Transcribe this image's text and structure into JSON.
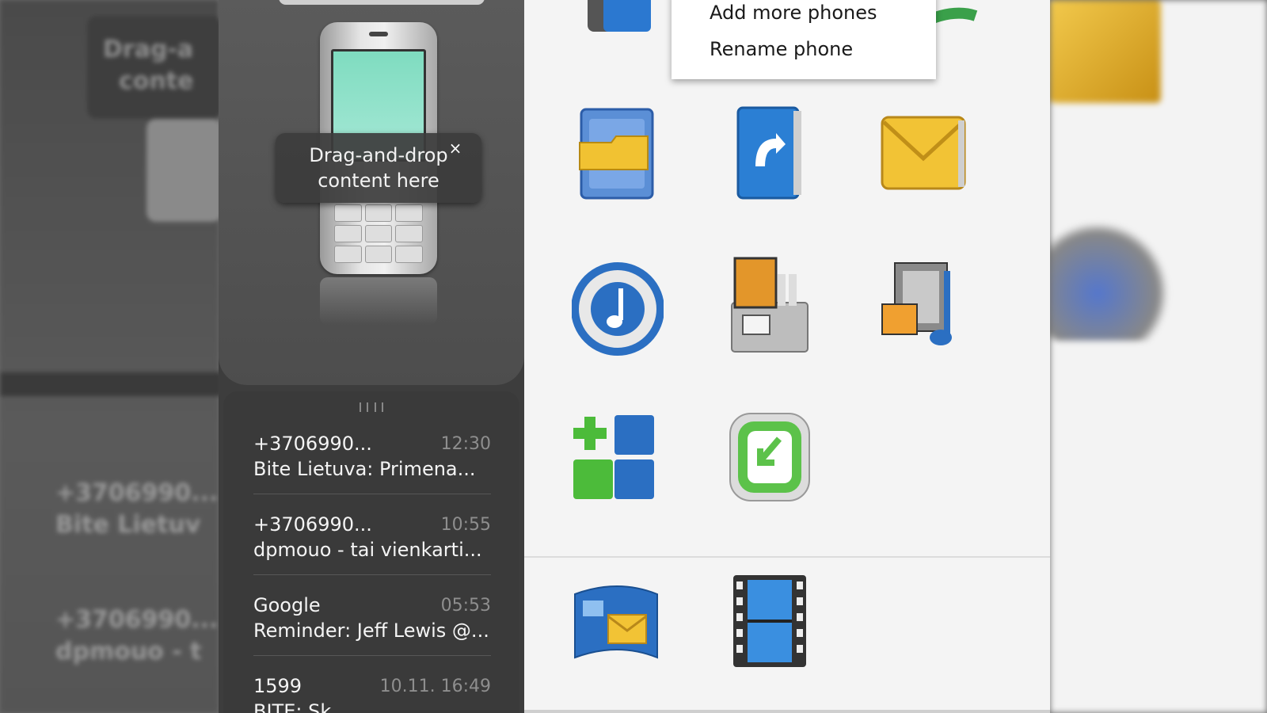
{
  "drop_tip": {
    "line1": "Drag-and-drop",
    "line2": "content here",
    "close_glyph": "×"
  },
  "context_menu": {
    "items": [
      {
        "label": "Add more phones"
      },
      {
        "label": "Rename phone"
      }
    ]
  },
  "messages": [
    {
      "sender": "+3706990...",
      "time": "12:30",
      "preview": "Bite Lietuva: Primena..."
    },
    {
      "sender": "+3706990...",
      "time": "10:55",
      "preview": "dpmouo - tai vienkarti..."
    },
    {
      "sender": "Google",
      "time": "05:53",
      "preview": "Reminder: Jeff Lewis @..."
    },
    {
      "sender": "1599",
      "time": "10.11. 16:49",
      "preview": "BITE: Sk..."
    }
  ],
  "background_ghost_text": {
    "left_1": "+3706990...",
    "left_1b": "Bite Lietuv",
    "left_2": "+3706990...",
    "left_2b": "dpmouo - t",
    "left_top_1": "Drag-a",
    "left_top_2": "conte"
  },
  "icons": [
    {
      "name": "backup-icon"
    },
    {
      "name": "contacts-sync-icon"
    },
    {
      "name": "file-manager-icon"
    },
    {
      "name": "contacts-book-icon"
    },
    {
      "name": "messaging-icon"
    },
    {
      "name": "music-manager-icon"
    },
    {
      "name": "photo-transfer-icon"
    },
    {
      "name": "multimedia-icon"
    },
    {
      "name": "more-applications-icon"
    },
    {
      "name": "software-installer-icon"
    },
    {
      "name": "online-share-icon"
    },
    {
      "name": "video-manager-icon"
    }
  ],
  "colors": {
    "panel_dark": "#3d3d3d",
    "icon_area_bg": "#f4f4f4",
    "accent_blue": "#2b6fc2",
    "accent_green": "#4cbb3a",
    "accent_yellow": "#f0c030"
  }
}
